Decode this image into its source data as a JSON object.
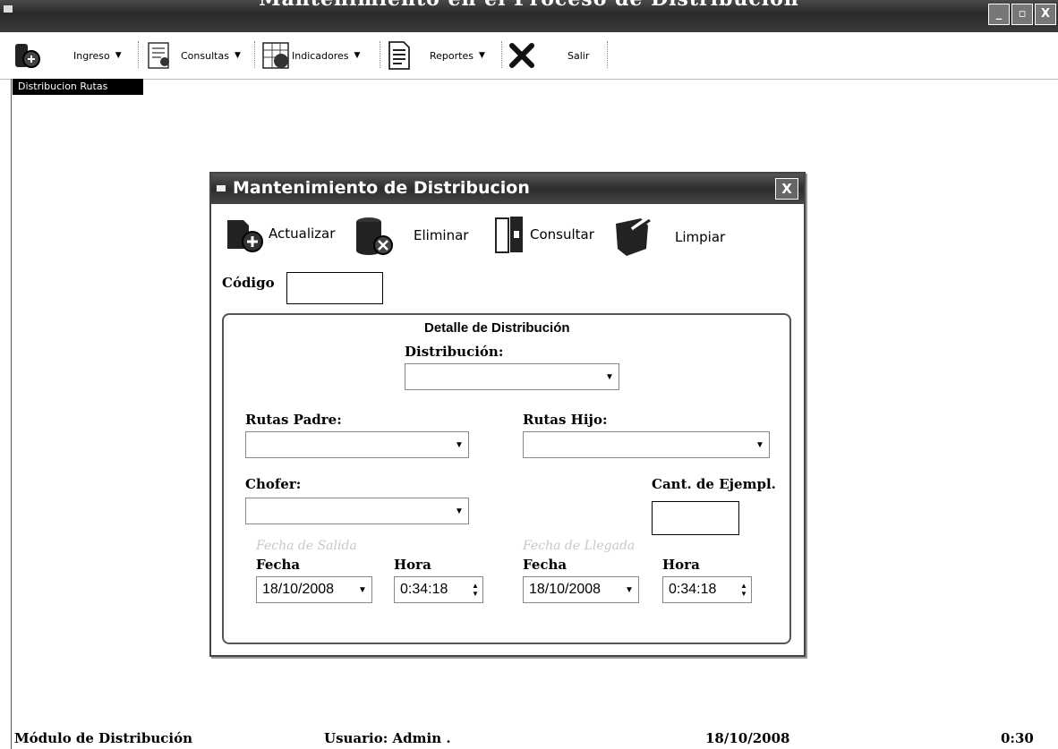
{
  "window": {
    "title": "Mantenimiento en el Proceso de Distribución",
    "controls": [
      "_",
      "▫",
      "X"
    ]
  },
  "menu": {
    "items": [
      {
        "label": "Ingreso",
        "icon": "ingreso-icon"
      },
      {
        "label": "Consultas",
        "icon": "consultas-icon"
      },
      {
        "label": "Indicadores",
        "icon": "indicadores-icon"
      },
      {
        "label": "Reportes",
        "icon": "reportes-icon"
      },
      {
        "label": "Salir",
        "icon": "salir-icon"
      }
    ],
    "submenu_item": "Distribucion Rutas"
  },
  "dialog": {
    "title": "Mantenimiento de Distribucion",
    "close": "X",
    "toolbar": {
      "actualizar": "Actualizar",
      "eliminar": "Eliminar",
      "consultar": "Consultar",
      "limpiar": "Limpiar"
    },
    "codigo_label": "Código",
    "codigo_value": "",
    "group": {
      "title": "Detalle de Distribución",
      "distribucion_label": "Distribución:",
      "distribucion_value": "",
      "rutas_padre_label": "Rutas Padre:",
      "rutas_padre_value": "",
      "rutas_hijo_label": "Rutas Hijo:",
      "rutas_hijo_value": "",
      "chofer_label": "Chofer:",
      "chofer_value": "",
      "cant_label": "Cant. de Ejempl.",
      "cant_value": "",
      "fecha_salida_caption": "Fecha de Salida",
      "fecha_llegada_caption": "Fecha de Llegada",
      "fecha_label": "Fecha",
      "hora_label": "Hora",
      "salida_fecha": "18/10/2008",
      "salida_hora": "0:34:18",
      "llegada_fecha": "18/10/2008",
      "llegada_hora": "0:34:18"
    }
  },
  "status": {
    "module": "Módulo de Distribución",
    "user": "Usuario: Admin .",
    "date": "18/10/2008",
    "time": "0:30"
  }
}
